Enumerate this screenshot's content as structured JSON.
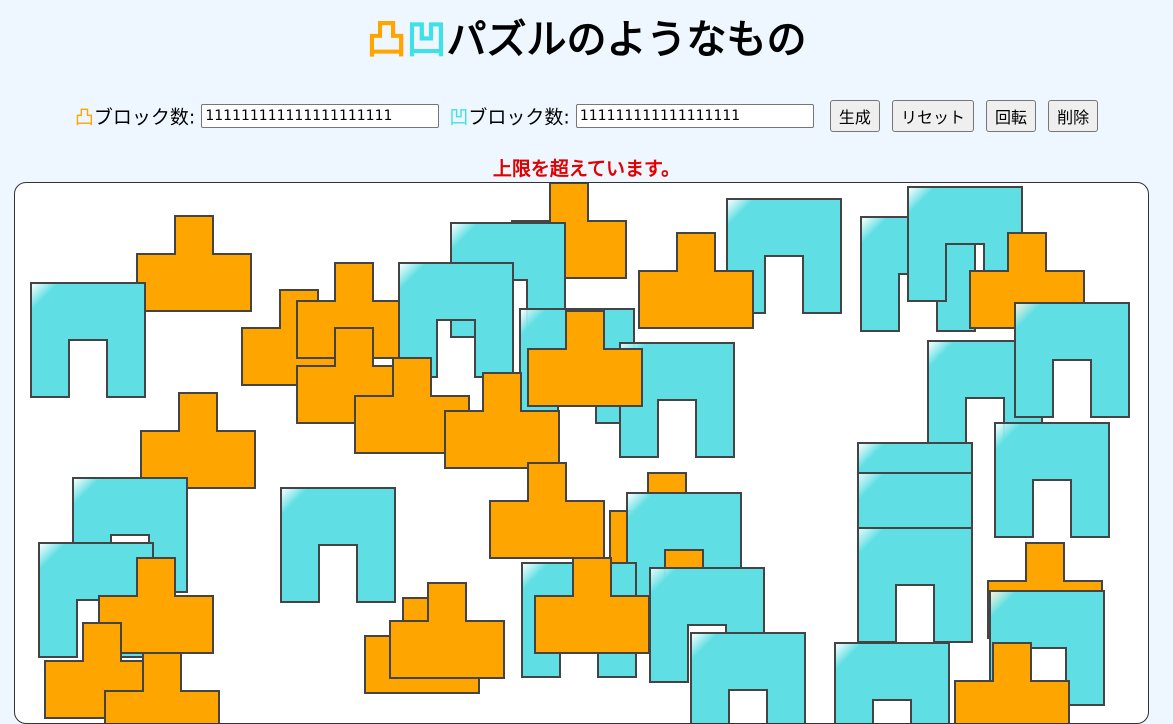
{
  "header": {
    "convex_glyph": "凸",
    "concave_glyph": "凹",
    "title_text": "パズルのようなもの"
  },
  "controls": {
    "convex_glyph": "凸",
    "convex_label": "ブロック数:",
    "convex_value": "111111111111111111111",
    "concave_glyph": "凹",
    "concave_label": "ブロック数:",
    "concave_value": "111111111111111111",
    "generate_label": "生成",
    "reset_label": "リセット",
    "rotate_label": "回転",
    "delete_label": "削除"
  },
  "warning": "上限を超えています。",
  "colors": {
    "convex": "#ffa500",
    "concave": "#5fdfe3",
    "outline": "#444444",
    "warning": "#e00000"
  }
}
